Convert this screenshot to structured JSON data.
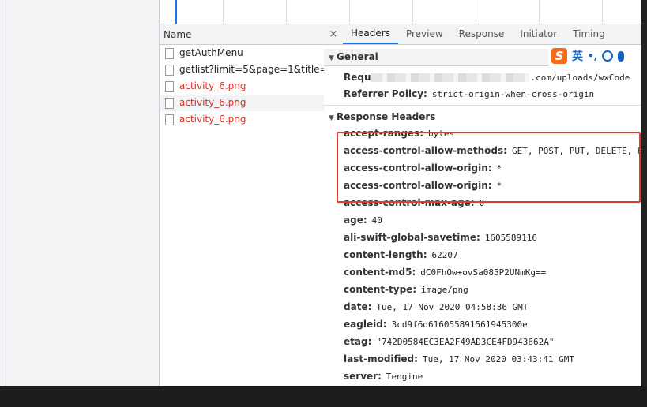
{
  "name_panel": {
    "header": "Name",
    "requests": [
      {
        "name": "getAuthMenu",
        "error": false,
        "selected": false
      },
      {
        "name": "getlist?limit=5&page=1&title=...",
        "error": false,
        "selected": false
      },
      {
        "name": "activity_6.png",
        "error": true,
        "selected": false
      },
      {
        "name": "activity_6.png",
        "error": true,
        "selected": true
      },
      {
        "name": "activity_6.png",
        "error": true,
        "selected": false
      }
    ]
  },
  "tabs": {
    "close": "×",
    "items": [
      "Headers",
      "Preview",
      "Response",
      "Initiator",
      "Timing"
    ],
    "active": "Headers"
  },
  "general": {
    "title": "General",
    "request_url_key": "Requ",
    "request_url_value": ".com/uploads/wxCode",
    "referrer_policy_key": "Referrer Policy:",
    "referrer_policy_value": "strict-origin-when-cross-origin"
  },
  "response_headers": {
    "title": "Response Headers",
    "items": [
      {
        "k": "accept-ranges:",
        "v": "bytes"
      },
      {
        "k": "access-control-allow-methods:",
        "v": "GET, POST, PUT, DELETE, HEAD"
      },
      {
        "k": "access-control-allow-origin:",
        "v": "*"
      },
      {
        "k": "access-control-allow-origin:",
        "v": "*"
      },
      {
        "k": "access-control-max-age:",
        "v": "0"
      },
      {
        "k": "age:",
        "v": "40"
      },
      {
        "k": "ali-swift-global-savetime:",
        "v": "1605589116"
      },
      {
        "k": "content-length:",
        "v": "62207"
      },
      {
        "k": "content-md5:",
        "v": "dC0FhOw+ovSa085P2UNmKg=="
      },
      {
        "k": "content-type:",
        "v": "image/png"
      },
      {
        "k": "date:",
        "v": "Tue, 17 Nov 2020 04:58:36 GMT"
      },
      {
        "k": "eagleid:",
        "v": "3cd9f6d616055891561945300e"
      },
      {
        "k": "etag:",
        "v": "\"742D0584EC3EA2F49AD3CE4FD943662A\""
      },
      {
        "k": "last-modified:",
        "v": "Tue, 17 Nov 2020 03:43:41 GMT"
      },
      {
        "k": "server:",
        "v": "Tengine"
      }
    ]
  },
  "ime": {
    "logo": "S",
    "lang": "英",
    "punct": "•,"
  },
  "colors": {
    "accent": "#1a73e8",
    "error": "#d93025",
    "highlight": "#e53935",
    "ime": "#f46b1e"
  }
}
